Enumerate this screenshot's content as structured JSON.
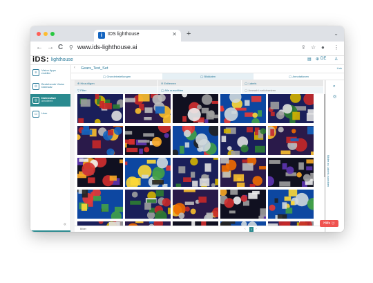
{
  "browser": {
    "tab_title": "IDS lighthouse",
    "tab_close": "✕",
    "new_tab": "+",
    "url": "www.ids-lighthouse.ai",
    "back": "←",
    "forward": "→",
    "reload": "C",
    "menu": "⋮",
    "colors": {
      "close": "#ff5f57",
      "minimize": "#febc2e",
      "maximize": "#28c840"
    }
  },
  "app": {
    "logo": "iDS:",
    "logo_sub": "lighthouse",
    "language": "DE"
  },
  "sidebar": {
    "items": [
      {
        "label": "Vision Apps",
        "sub": "erstellen",
        "icon": "≡"
      },
      {
        "label": "Bestehende Vision",
        "sub": "Datensatz",
        "icon": "⊙"
      },
      {
        "label": "Datensätze",
        "sub": "annotieren",
        "icon": "◎"
      },
      {
        "label": "User",
        "sub": "",
        "icon": "▭"
      }
    ],
    "collapse": "«"
  },
  "main": {
    "back": "‹",
    "dataset_name": "Gears_Test_Set",
    "right_action": "Link",
    "steps": [
      {
        "label": "◯ Grundeinstellungen"
      },
      {
        "label": "◯ Bilddaten"
      },
      {
        "label": "◯ Annotationen"
      }
    ],
    "toolbar": {
      "add": "⊕ Hinzufügen",
      "remove": "⊖ Entfernen",
      "label": "◯ Labels",
      "filter": "▽ Filter",
      "select_all": "◯ Alle auswählen",
      "reset": "◯ Auswahl zurücksetzen"
    },
    "pager": {
      "label": "Bilder",
      "page": "1",
      "prev": "‹",
      "next": "›"
    },
    "right_panel": {
      "collapse": "«",
      "label": "Bilder zu Labels zuordnen"
    },
    "help": "Hilfe ⓧ"
  }
}
